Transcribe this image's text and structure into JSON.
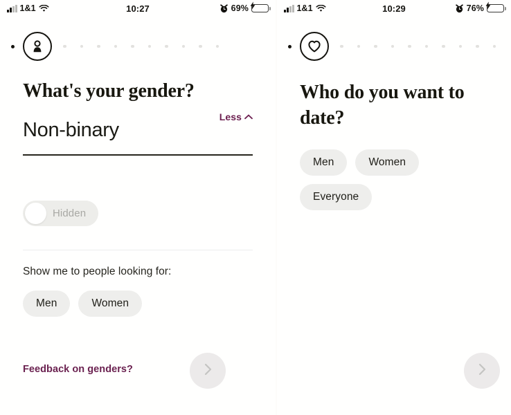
{
  "meta": {
    "accent_purple": "#6d2050",
    "chip_bg": "#eeeeec",
    "text_dark": "#18170f",
    "toggle_bg": "#ededea",
    "battery_green": "#3ccf4e"
  },
  "screens": [
    {
      "status": {
        "carrier": "1&1",
        "time": "10:27",
        "battery_percent": "69%",
        "signal_icon": "cellular-bars-icon",
        "wifi_icon": "wifi-icon",
        "alarm_icon": "alarm-clock-icon",
        "battery_icon": "battery-charging-icon"
      },
      "progress": {
        "completed_dots": 1,
        "remaining_dots": 10,
        "current_step_icon": "person-icon"
      },
      "title": "What's your gender?",
      "field": {
        "value": "Non-binary",
        "toggle_link_label": "Less",
        "toggle_link_icon": "chevron-up-icon"
      },
      "hidden_toggle": {
        "label": "Hidden",
        "state": "off",
        "knob_icon": "toggle-knob"
      },
      "section_label": "Show me to people looking for:",
      "chips": [
        "Men",
        "Women"
      ],
      "footer": {
        "feedback_label": "Feedback on genders?",
        "next_icon": "chevron-right-icon"
      }
    },
    {
      "status": {
        "carrier": "1&1",
        "time": "10:29",
        "battery_percent": "76%",
        "signal_icon": "cellular-bars-icon",
        "wifi_icon": "wifi-icon",
        "alarm_icon": "alarm-clock-icon",
        "battery_icon": "battery-charging-icon"
      },
      "progress": {
        "completed_dots": 1,
        "remaining_dots": 10,
        "current_step_icon": "heart-icon"
      },
      "title": "Who do you want to date?",
      "chips": [
        "Men",
        "Women",
        "Everyone"
      ],
      "footer": {
        "next_icon": "chevron-right-icon"
      }
    }
  ]
}
